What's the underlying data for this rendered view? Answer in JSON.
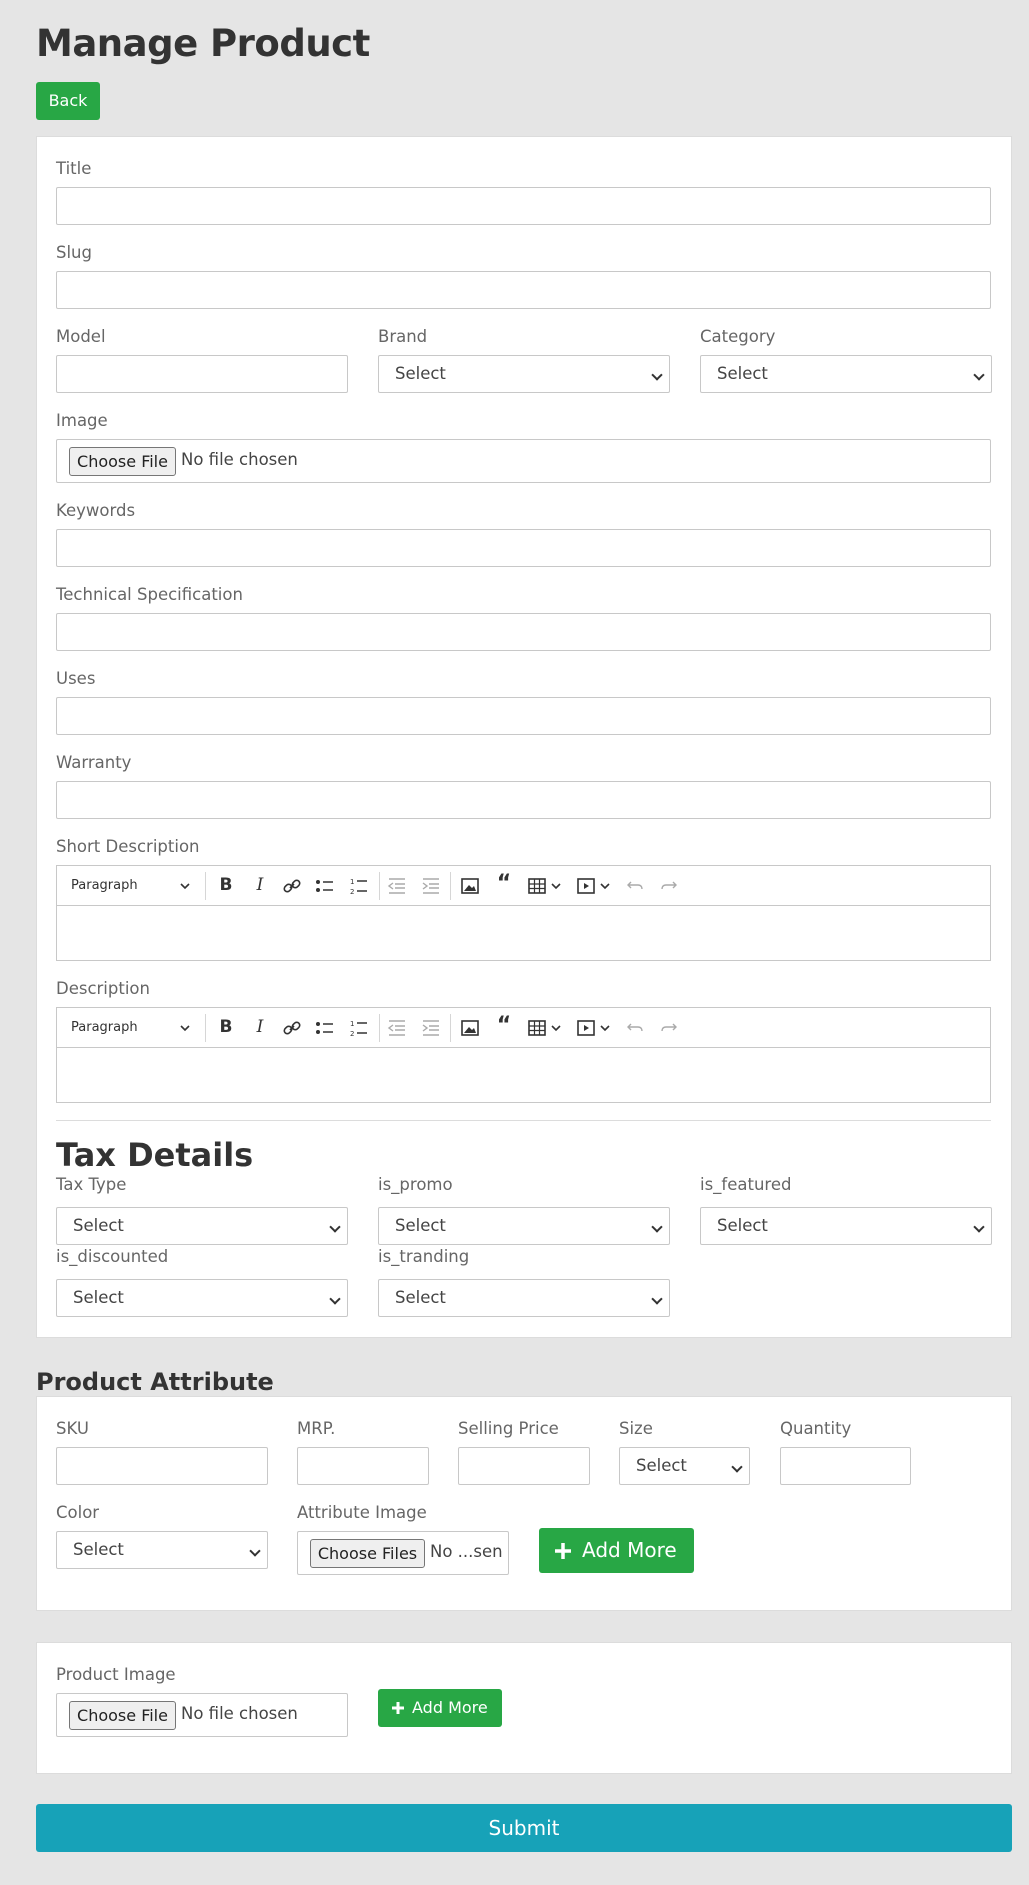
{
  "header": {
    "title": "Manage Product",
    "back_label": "Back"
  },
  "form": {
    "title_label": "Title",
    "slug_label": "Slug",
    "model_label": "Model",
    "brand_label": "Brand",
    "brand_value": "Select",
    "category_label": "Category",
    "category_value": "Select",
    "image_label": "Image",
    "image_button": "Choose File",
    "image_status": "No file chosen",
    "keywords_label": "Keywords",
    "techspec_label": "Technical Specification",
    "uses_label": "Uses",
    "warranty_label": "Warranty",
    "short_desc_label": "Short Description",
    "desc_label": "Description",
    "editor_paragraph": "Paragraph"
  },
  "tax": {
    "heading": "Tax Details",
    "tax_type_label": "Tax Type",
    "is_promo_label": "is_promo",
    "is_featured_label": "is_featured",
    "is_discounted_label": "is_discounted",
    "is_tranding_label": "is_tranding",
    "select_value": "Select"
  },
  "attribute": {
    "heading": "Product Attribute",
    "sku_label": "SKU",
    "mrp_label": "MRP.",
    "selling_label": "Selling Price",
    "size_label": "Size",
    "size_value": "Select",
    "quantity_label": "Quantity",
    "color_label": "Color",
    "color_value": "Select",
    "attr_image_label": "Attribute Image",
    "attr_image_button": "Choose Files",
    "attr_image_status": "No ...sen",
    "add_more_label": "Add More"
  },
  "product_image": {
    "label": "Product Image",
    "button": "Choose File",
    "status": "No file chosen",
    "add_more_label": "Add More"
  },
  "submit_label": "Submit",
  "colors": {
    "green": "#28a745",
    "teal": "#17a2b8"
  }
}
